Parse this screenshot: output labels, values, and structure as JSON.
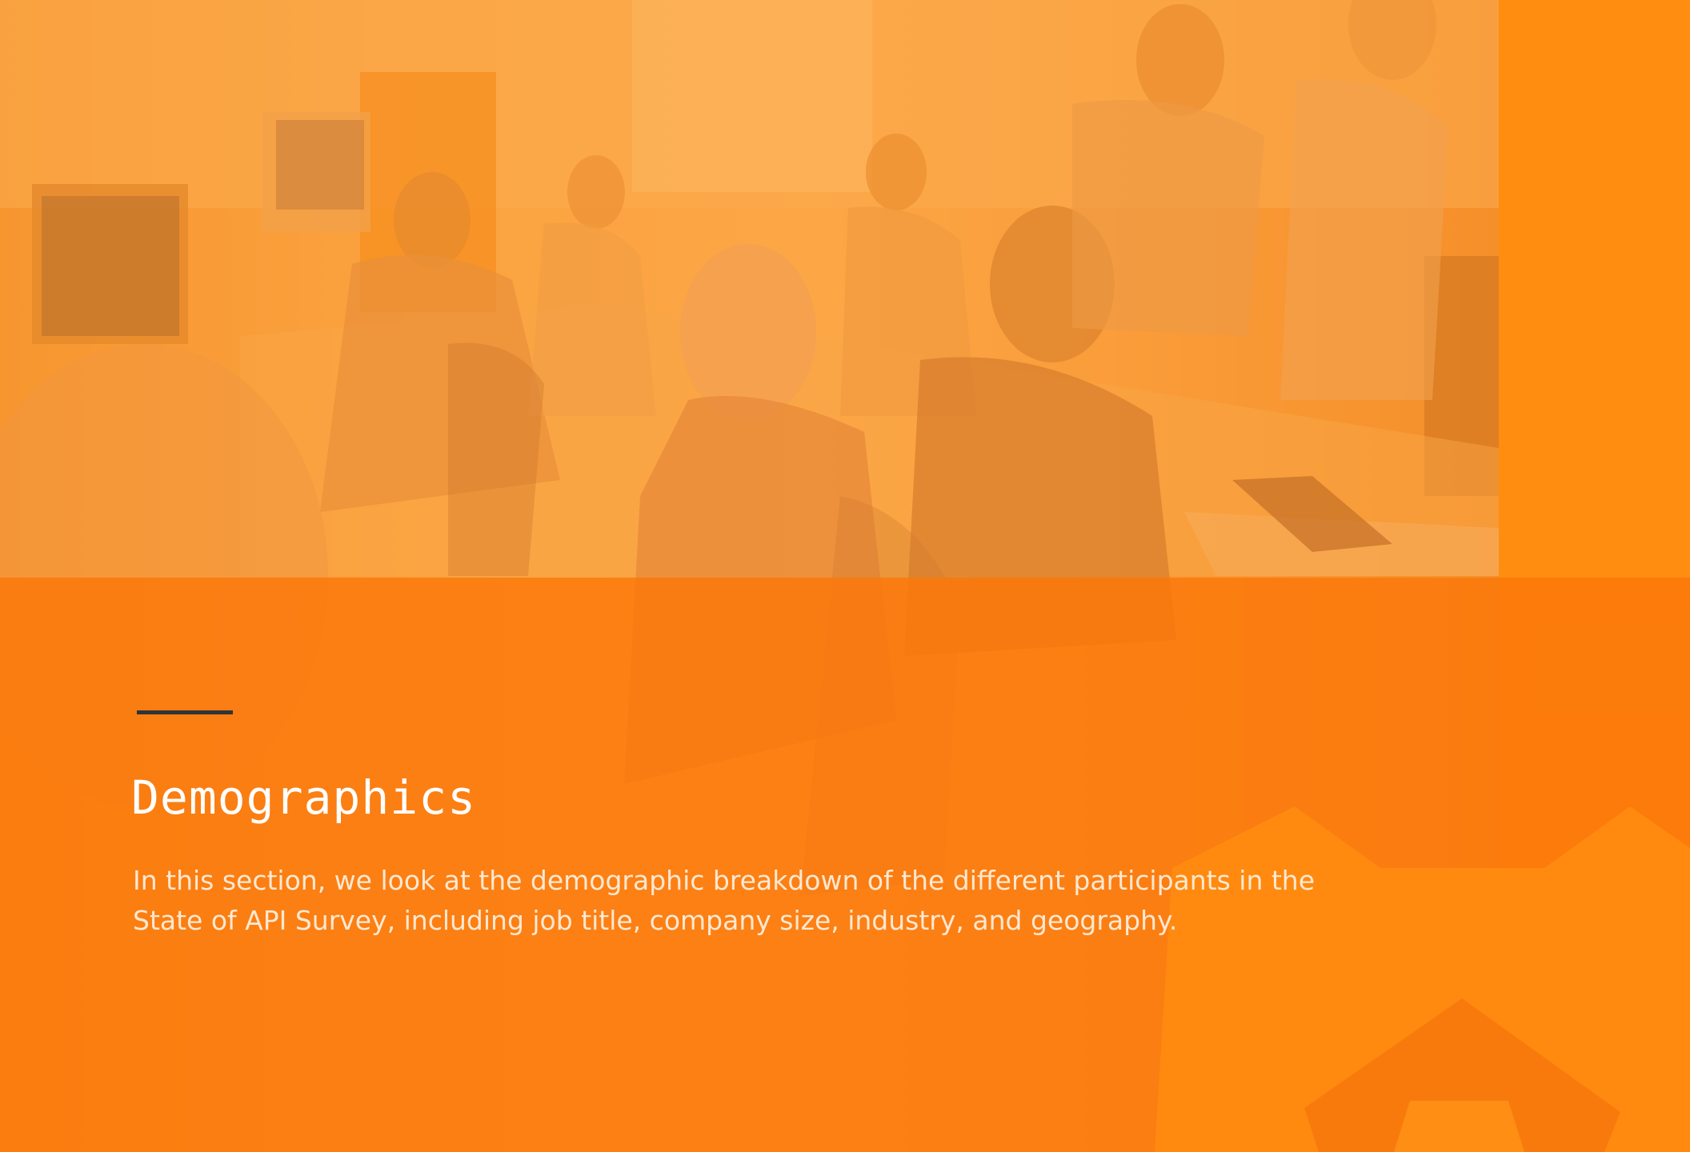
{
  "section": {
    "title": "Demographics",
    "description": "In this section, we look at the demographic breakdown of the different participants in the State of API Survey, including job title, company size, industry, and geography."
  },
  "colors": {
    "background": "#ff8c0f",
    "band": "#fb780a",
    "rule": "#2f3438",
    "title": "#ffffff",
    "description": "#ffe8d2"
  }
}
